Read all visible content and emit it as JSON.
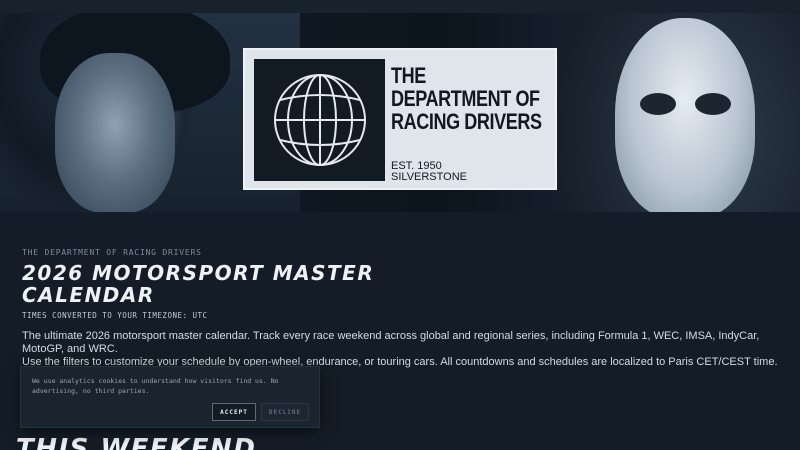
{
  "hero": {
    "logo": {
      "title_lines": [
        "THE",
        "DEPARTMENT OF",
        "RACING DRIVERS"
      ],
      "established": "EST. 1950",
      "location": "SILVERSTONE"
    }
  },
  "header": {
    "kicker": "THE DEPARTMENT OF RACING DRIVERS",
    "title": "2026 MOTORSPORT MASTER CALENDAR",
    "timezone_note": "TIMES CONVERTED TO YOUR TIMEZONE: UTC",
    "description_1": "The ultimate 2026 motorsport master calendar. Track every race weekend across global and regional series, including Formula 1, WEC, IMSA, IndyCar, MotoGP, and WRC.",
    "description_2": "Use the filters to customize your schedule by open-wheel, endurance, or touring cars. All countdowns and schedules are localized to Paris CET/CEST time."
  },
  "cookie_banner": {
    "text": "We use analytics cookies to understand how visitors find us. No advertising, no third parties.",
    "accept_label": "ACCEPT",
    "decline_label": "DECLINE"
  },
  "sections": {
    "this_weekend": "THIS WEEKEND"
  },
  "colors": {
    "background": "#141d27",
    "logo_card": "#dfe5ea",
    "text_primary": "#eef2f6"
  }
}
